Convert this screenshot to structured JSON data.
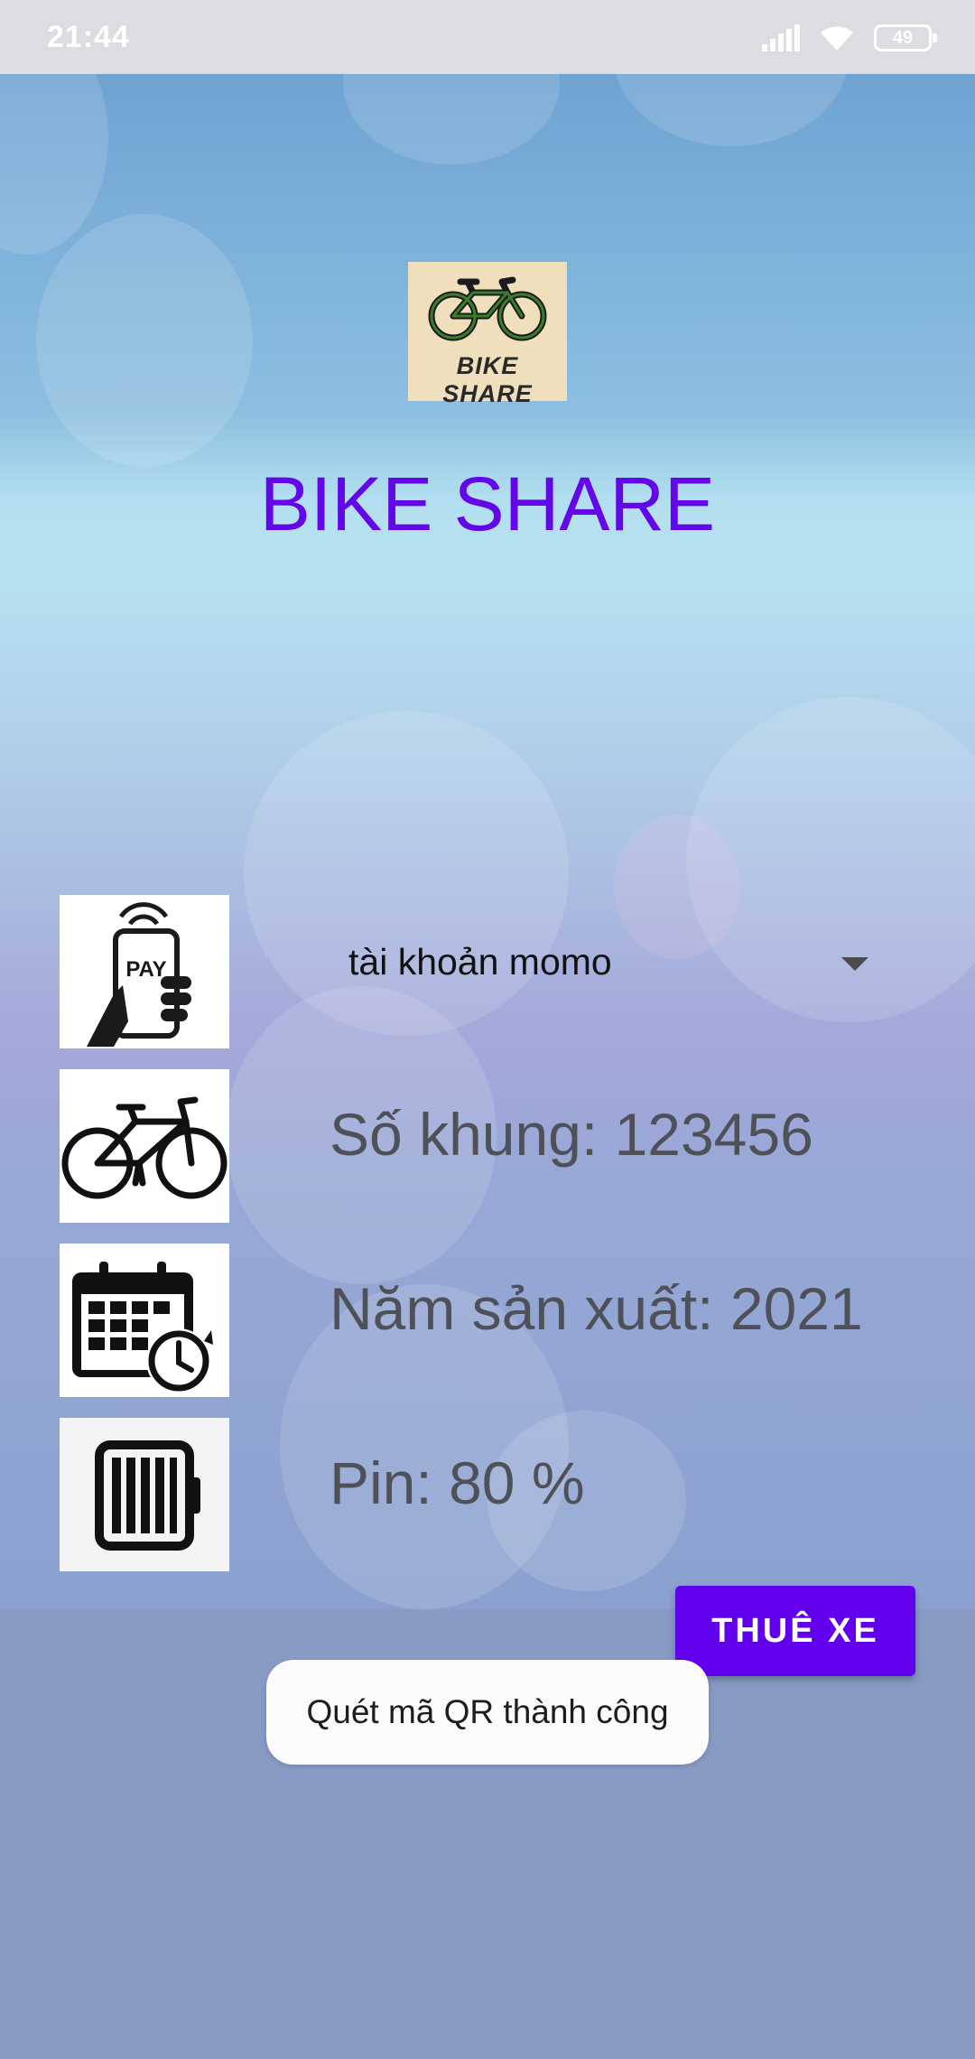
{
  "status_bar": {
    "time": "21:44",
    "battery": "49",
    "icons": [
      "signal-icon",
      "wifi-icon",
      "battery-icon"
    ]
  },
  "logo": {
    "text": "BIKE SHARE",
    "icon": "bicycle-icon"
  },
  "app_title": "BIKE SHARE",
  "payment": {
    "icon": "pay-phone-icon",
    "selected_value": "tài khoản momo",
    "dropdown_icon": "dropdown-arrow-icon"
  },
  "bike_info": {
    "frame_number": "Số khung: 123456",
    "frame_icon": "bicycle-icon",
    "year": "Năm sản xuất: 2021",
    "year_icon": "calendar-clock-icon",
    "battery": "Pin: 80 %",
    "battery_icon": "battery-icon"
  },
  "rent_button": {
    "label": "THUÊ XE"
  },
  "toast": {
    "message": "Quét mã QR thành công"
  },
  "colors": {
    "accent": "#6200ee",
    "title": "#6306e8",
    "info_text": "#4f5159"
  }
}
